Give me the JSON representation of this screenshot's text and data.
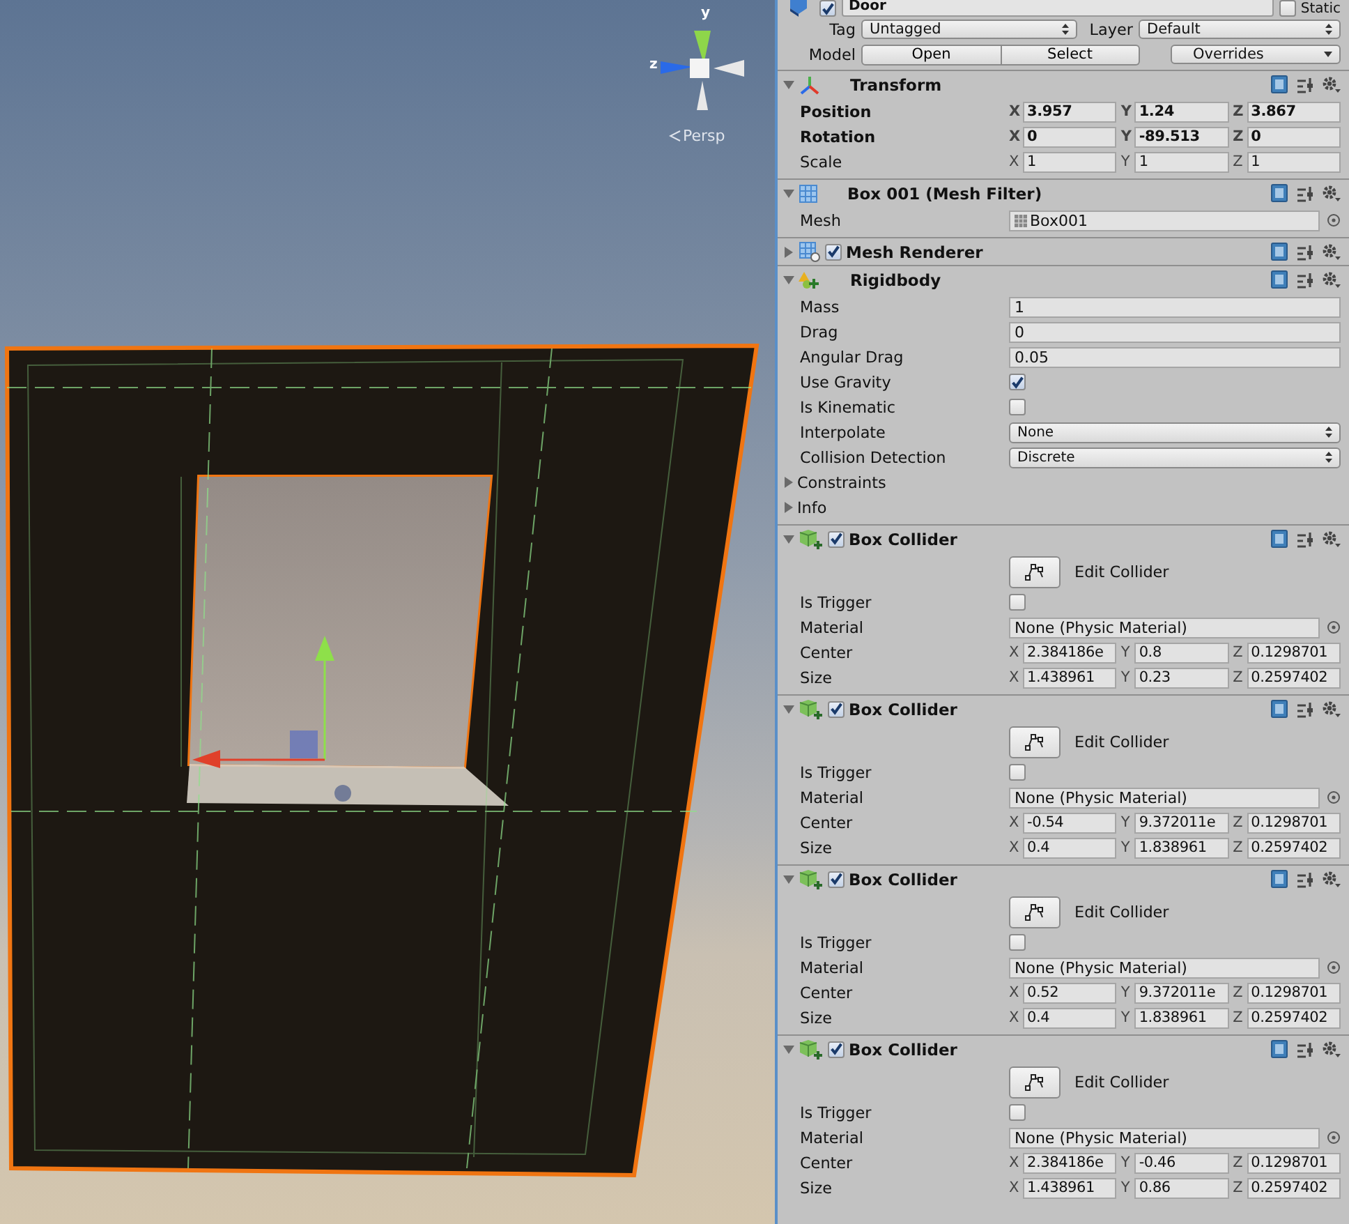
{
  "scene_view": {
    "gizmo": {
      "y_label": "y",
      "z_label": "z",
      "projection": "Persp"
    }
  },
  "inspector": {
    "object": {
      "active": true,
      "name": "Door",
      "static_label": "Static",
      "static": false
    },
    "tag": {
      "label": "Tag",
      "value": "Untagged"
    },
    "layer": {
      "label": "Layer",
      "value": "Default"
    },
    "model": {
      "label": "Model",
      "buttons": [
        "Open",
        "Select"
      ],
      "overrides": "Overrides"
    },
    "components": [
      {
        "kind": "transform",
        "title": "Transform",
        "expanded": true,
        "rows": [
          {
            "kind": "vector3",
            "label": "Position",
            "overridden": true,
            "values": [
              {
                "axis": "X",
                "value": "3.957"
              },
              {
                "axis": "Y",
                "value": "1.24"
              },
              {
                "axis": "Z",
                "value": "3.867"
              }
            ]
          },
          {
            "kind": "vector3",
            "label": "Rotation",
            "overridden": true,
            "values": [
              {
                "axis": "X",
                "value": "0"
              },
              {
                "axis": "Y",
                "value": "-89.513"
              },
              {
                "axis": "Z",
                "value": "0"
              }
            ]
          },
          {
            "kind": "vector3",
            "label": "Scale",
            "overridden": false,
            "values": [
              {
                "axis": "X",
                "value": "1"
              },
              {
                "axis": "Y",
                "value": "1"
              },
              {
                "axis": "Z",
                "value": "1"
              }
            ]
          }
        ]
      },
      {
        "kind": "mesh_filter",
        "title": "Box 001 (Mesh Filter)",
        "expanded": true,
        "rows": [
          {
            "kind": "mesh",
            "label": "Mesh",
            "value": "Box001"
          }
        ]
      },
      {
        "kind": "mesh_renderer",
        "title": "Mesh Renderer",
        "expanded": false,
        "enabled": true
      },
      {
        "kind": "rigidbody",
        "title": "Rigidbody",
        "expanded": true,
        "rows": [
          {
            "kind": "number",
            "label": "Mass",
            "value": "1"
          },
          {
            "kind": "number",
            "label": "Drag",
            "value": "0"
          },
          {
            "kind": "number",
            "label": "Angular Drag",
            "value": "0.05"
          },
          {
            "kind": "checkbox",
            "label": "Use Gravity",
            "checked": true
          },
          {
            "kind": "checkbox",
            "label": "Is Kinematic",
            "checked": false
          },
          {
            "kind": "dropdown",
            "label": "Interpolate",
            "value": "None"
          },
          {
            "kind": "dropdown",
            "label": "Collision Detection",
            "value": "Discrete"
          },
          {
            "kind": "foldout",
            "label": "Constraints",
            "expanded": false
          },
          {
            "kind": "foldout",
            "label": "Info",
            "expanded": false
          }
        ]
      },
      {
        "kind": "box_collider",
        "title": "Box Collider",
        "expanded": true,
        "enabled": true,
        "rows": [
          {
            "kind": "edit_button",
            "label": "Edit Collider"
          },
          {
            "kind": "checkbox",
            "label": "Is Trigger",
            "checked": false
          },
          {
            "kind": "object",
            "label": "Material",
            "value": "None (Physic Material)"
          },
          {
            "kind": "vector3",
            "label": "Center",
            "overridden": false,
            "values": [
              {
                "axis": "X",
                "value": "2.384186e"
              },
              {
                "axis": "Y",
                "value": "0.8"
              },
              {
                "axis": "Z",
                "value": "0.1298701"
              }
            ]
          },
          {
            "kind": "vector3",
            "label": "Size",
            "overridden": false,
            "values": [
              {
                "axis": "X",
                "value": "1.438961"
              },
              {
                "axis": "Y",
                "value": "0.23"
              },
              {
                "axis": "Z",
                "value": "0.2597402"
              }
            ]
          }
        ]
      },
      {
        "kind": "box_collider",
        "title": "Box Collider",
        "expanded": true,
        "enabled": true,
        "rows": [
          {
            "kind": "edit_button",
            "label": "Edit Collider"
          },
          {
            "kind": "checkbox",
            "label": "Is Trigger",
            "checked": false
          },
          {
            "kind": "object",
            "label": "Material",
            "value": "None (Physic Material)"
          },
          {
            "kind": "vector3",
            "label": "Center",
            "overridden": false,
            "values": [
              {
                "axis": "X",
                "value": "-0.54"
              },
              {
                "axis": "Y",
                "value": "9.372011e"
              },
              {
                "axis": "Z",
                "value": "0.1298701"
              }
            ]
          },
          {
            "kind": "vector3",
            "label": "Size",
            "overridden": false,
            "values": [
              {
                "axis": "X",
                "value": "0.4"
              },
              {
                "axis": "Y",
                "value": "1.838961"
              },
              {
                "axis": "Z",
                "value": "0.2597402"
              }
            ]
          }
        ]
      },
      {
        "kind": "box_collider",
        "title": "Box Collider",
        "expanded": true,
        "enabled": true,
        "rows": [
          {
            "kind": "edit_button",
            "label": "Edit Collider"
          },
          {
            "kind": "checkbox",
            "label": "Is Trigger",
            "checked": false
          },
          {
            "kind": "object",
            "label": "Material",
            "value": "None (Physic Material)"
          },
          {
            "kind": "vector3",
            "label": "Center",
            "overridden": false,
            "values": [
              {
                "axis": "X",
                "value": "0.52"
              },
              {
                "axis": "Y",
                "value": "9.372011e"
              },
              {
                "axis": "Z",
                "value": "0.1298701"
              }
            ]
          },
          {
            "kind": "vector3",
            "label": "Size",
            "overridden": false,
            "values": [
              {
                "axis": "X",
                "value": "0.4"
              },
              {
                "axis": "Y",
                "value": "1.838961"
              },
              {
                "axis": "Z",
                "value": "0.2597402"
              }
            ]
          }
        ]
      },
      {
        "kind": "box_collider",
        "title": "Box Collider",
        "expanded": true,
        "enabled": true,
        "rows": [
          {
            "kind": "edit_button",
            "label": "Edit Collider"
          },
          {
            "kind": "checkbox",
            "label": "Is Trigger",
            "checked": false
          },
          {
            "kind": "object",
            "label": "Material",
            "value": "None (Physic Material)"
          },
          {
            "kind": "vector3",
            "label": "Center",
            "overridden": false,
            "values": [
              {
                "axis": "X",
                "value": "2.384186e"
              },
              {
                "axis": "Y",
                "value": "-0.46"
              },
              {
                "axis": "Z",
                "value": "0.1298701"
              }
            ]
          },
          {
            "kind": "vector3",
            "label": "Size",
            "overridden": false,
            "values": [
              {
                "axis": "X",
                "value": "1.438961"
              },
              {
                "axis": "Y",
                "value": "0.86"
              },
              {
                "axis": "Z",
                "value": "0.2597402"
              }
            ]
          }
        ]
      }
    ]
  }
}
